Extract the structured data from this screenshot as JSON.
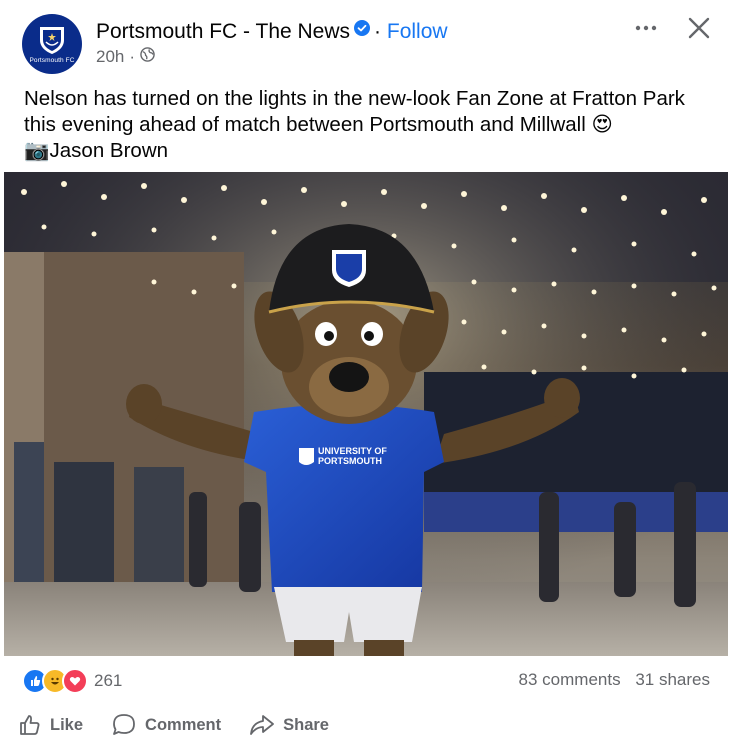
{
  "post": {
    "page_name": "Portsmouth FC - The News",
    "follow_label": "Follow",
    "dot": "·",
    "avatar_text": "Portsmouth FC",
    "time_ago": "20h",
    "meta_dot": "·",
    "caption_line1": "Nelson has turned on the lights in the new-look Fan Zone at Fratton Park this evening ahead of match between Portsmouth and Millwall 😍",
    "caption_line2": "📷Jason Brown",
    "shirt_sponsor_line1": "UNIVERSITY OF",
    "shirt_sponsor_line2": "PORTSMOUTH"
  },
  "engagement": {
    "reaction_count": "261",
    "comments": "83 comments",
    "shares": "31 shares"
  },
  "actions": {
    "like": "Like",
    "comment": "Comment",
    "share": "Share"
  },
  "colors": {
    "accent": "#1877f2",
    "secondary_text": "#65676b",
    "avatar_bg": "#0a2c8a"
  },
  "icons": [
    "verified-badge-icon",
    "globe-icon",
    "more-options-icon",
    "close-icon",
    "like-reaction-icon",
    "haha-reaction-icon",
    "love-reaction-icon",
    "like-icon",
    "comment-icon",
    "share-icon"
  ]
}
